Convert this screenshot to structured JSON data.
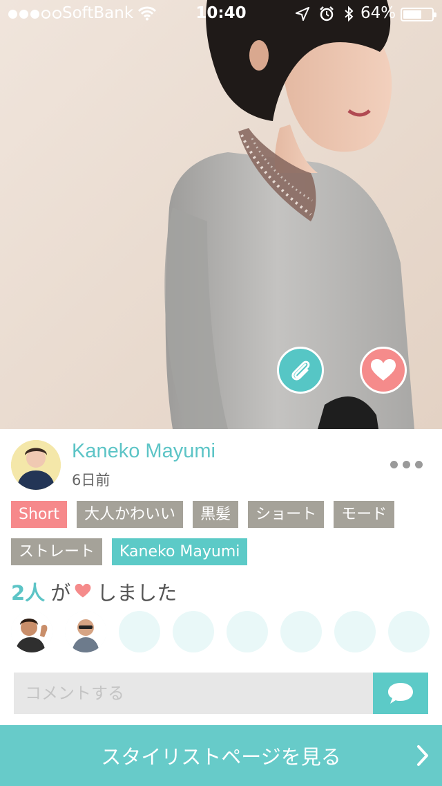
{
  "status_bar": {
    "carrier": "SoftBank",
    "time": "10:40",
    "battery_percent": "64%",
    "battery_level": 0.64,
    "signal_bars_filled": 3,
    "signal_bars_total": 5,
    "icons": [
      "wifi-icon",
      "location-arrow-icon",
      "alarm-icon",
      "bluetooth-icon",
      "battery-icon"
    ]
  },
  "photo": {
    "actions": {
      "clip_icon": "paperclip-icon",
      "like_icon": "heart-icon"
    }
  },
  "author": {
    "name": "Kaneko Mayumi",
    "posted": "6日前"
  },
  "tags": [
    {
      "label": "Short",
      "style": "pink"
    },
    {
      "label": "大人かわいい",
      "style": "gray"
    },
    {
      "label": "黒髪",
      "style": "gray"
    },
    {
      "label": "ショート",
      "style": "gray"
    },
    {
      "label": "モード",
      "style": "gray"
    },
    {
      "label": "ストレート",
      "style": "gray"
    },
    {
      "label": "Kaneko Mayumi",
      "style": "teal"
    }
  ],
  "likes": {
    "count": "2人",
    "connector": "が",
    "suffix": "しました",
    "liker_slots": 8,
    "liker_avatars": 2
  },
  "comment": {
    "placeholder": "コメントする",
    "send_icon": "speech-bubble-icon"
  },
  "cta": {
    "label": "スタイリストページを見る",
    "icon": "chevron-right-icon"
  },
  "colors": {
    "accent_teal": "#5ccac7",
    "accent_pink": "#f6898b",
    "tag_gray": "#a5a299",
    "cta_bg": "#67cbc9"
  }
}
